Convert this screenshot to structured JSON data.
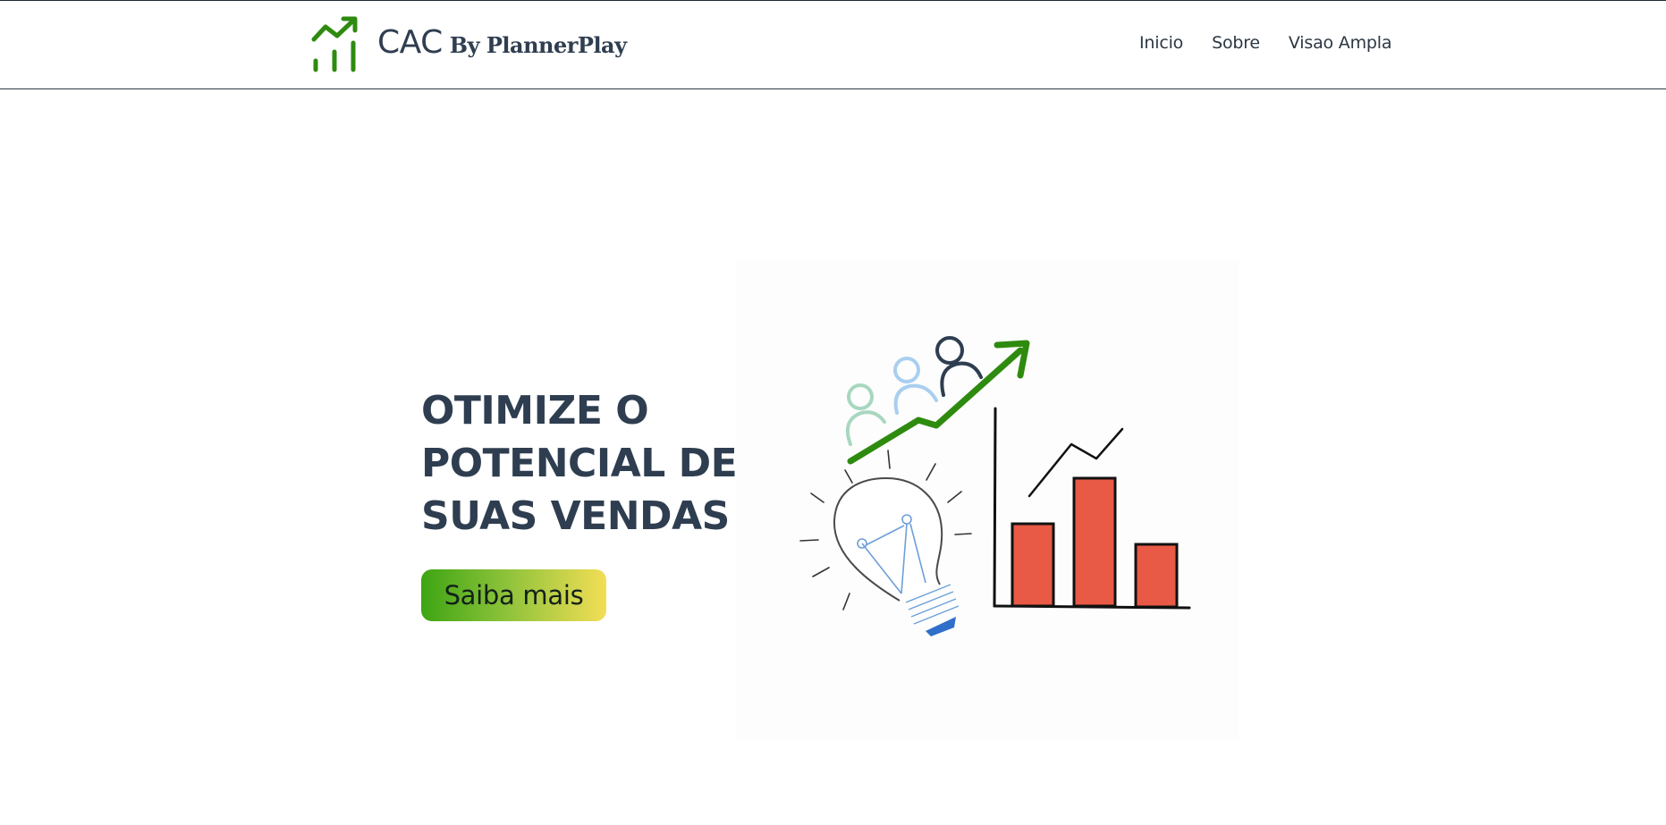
{
  "header": {
    "brand_name": "CAC",
    "brand_by": "By PlannerPlay",
    "logo_icon": "trending-up-bars-icon",
    "nav": [
      {
        "label": "Inicio"
      },
      {
        "label": "Sobre"
      },
      {
        "label": "Visao Ampla"
      }
    ]
  },
  "hero": {
    "title_lines": [
      "OTIMIZE O",
      "POTENCIAL DE",
      "SUAS VENDAS"
    ],
    "button_label": "Saiba mais",
    "illustration_icon": "lightbulb-growth-chart-illustration"
  },
  "colors": {
    "brand_green": "#2e8b0f",
    "text_dark": "#2e3e50",
    "bar_red": "#e85a45",
    "button_gradient_start": "#3ea513",
    "button_gradient_end": "#f2de55"
  }
}
